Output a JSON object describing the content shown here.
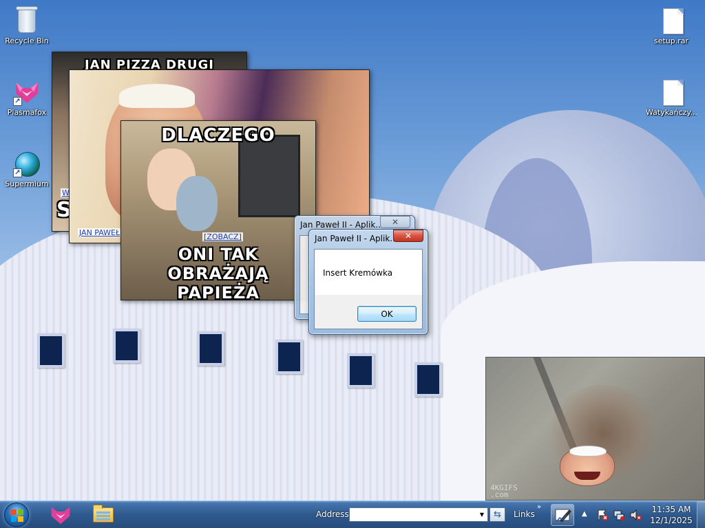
{
  "desktop": {
    "icons": [
      {
        "label": "Recycle Bin",
        "icon": "recycle-bin-icon"
      },
      {
        "label": "Plasmafox",
        "icon": "plasmafox-icon"
      },
      {
        "label": "Supermium",
        "icon": "supermium-icon"
      },
      {
        "label": "setup.rar",
        "icon": "file-icon"
      },
      {
        "label": "Watykańczy...",
        "icon": "file-icon"
      }
    ]
  },
  "memes": [
    {
      "top_text": "JAN PIZZA DRUGI",
      "side_text": "SI",
      "link": "W"
    },
    {
      "link": "JAN PAWEŁ"
    },
    {
      "top_text": "DLACZEGO",
      "bottom_text": "ONI TAK OBRAŻAJĄ PAPIEŻA",
      "link": "[ZOBACZ]"
    }
  ],
  "dialogs": {
    "back": {
      "title": "Jan Paweł II - Aplik...",
      "close": "✕"
    },
    "front": {
      "title": "Jan Paweł II - Aplik...",
      "close": "✕",
      "message": "Insert Kremówka",
      "ok_label": "OK"
    }
  },
  "gif": {
    "watermark": "4KGIFS\n.com"
  },
  "taskbar": {
    "address_label": "Address",
    "address_value": "",
    "links_label": "Links",
    "links_chevron": "»",
    "tray_chevron": "▲",
    "time": "11:35 AM",
    "date": "12/1/2025"
  },
  "colors": {
    "taskbar": "#2f5a8f",
    "dialog_frame": "#a9c4e3",
    "close_button": "#c2331f"
  }
}
